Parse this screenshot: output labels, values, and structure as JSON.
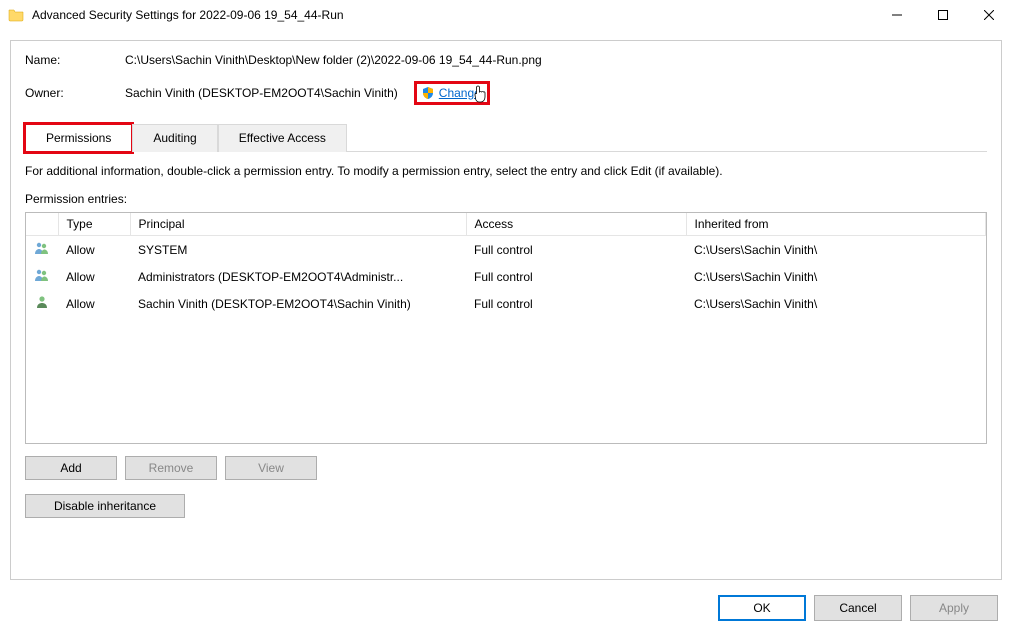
{
  "titlebar": {
    "title": "Advanced Security Settings for 2022-09-06 19_54_44-Run"
  },
  "info": {
    "name_label": "Name:",
    "name_value": "C:\\Users\\Sachin Vinith\\Desktop\\New folder (2)\\2022-09-06 19_54_44-Run.png",
    "owner_label": "Owner:",
    "owner_value": "Sachin Vinith (DESKTOP-EM2OOT4\\Sachin Vinith)",
    "change_label": "Change"
  },
  "tabs": {
    "permissions": "Permissions",
    "auditing": "Auditing",
    "effective": "Effective Access"
  },
  "help_text": "For additional information, double-click a permission entry. To modify a permission entry, select the entry and click Edit (if available).",
  "perm_entries_label": "Permission entries:",
  "table": {
    "headers": {
      "type": "Type",
      "principal": "Principal",
      "access": "Access",
      "inherited": "Inherited from"
    },
    "rows": [
      {
        "icon": "group",
        "type": "Allow",
        "principal": "SYSTEM",
        "access": "Full control",
        "inherited": "C:\\Users\\Sachin Vinith\\"
      },
      {
        "icon": "group",
        "type": "Allow",
        "principal": "Administrators (DESKTOP-EM2OOT4\\Administr...",
        "access": "Full control",
        "inherited": "C:\\Users\\Sachin Vinith\\"
      },
      {
        "icon": "user",
        "type": "Allow",
        "principal": "Sachin Vinith (DESKTOP-EM2OOT4\\Sachin Vinith)",
        "access": "Full control",
        "inherited": "C:\\Users\\Sachin Vinith\\"
      }
    ]
  },
  "buttons": {
    "add": "Add",
    "remove": "Remove",
    "view": "View",
    "disable_inh": "Disable inheritance",
    "ok": "OK",
    "cancel": "Cancel",
    "apply": "Apply"
  }
}
